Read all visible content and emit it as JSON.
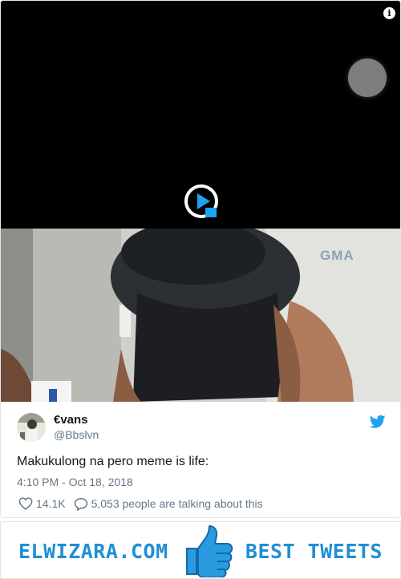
{
  "tweet": {
    "user_name": "€vans",
    "user_handle": "@Bbslvn",
    "text": "Makukulong na pero meme is life:",
    "time": "4:10 PM - Oct 18, 2018",
    "likes": "14.1K",
    "talking": "5,053 people are talking about this"
  },
  "video": {
    "watermark": "GMA",
    "icons": [
      "info-icon",
      "record-icon",
      "play-icon"
    ]
  },
  "banner": {
    "left_text": "ELWIZARA.COM",
    "right_text": "BEST TWEETS",
    "icon": "thumbs-up-icon"
  },
  "colors": {
    "twitter_blue": "#1da1f2",
    "text_primary": "#14171a",
    "text_secondary": "#657786",
    "banner_blue": "#1f8fd4"
  }
}
